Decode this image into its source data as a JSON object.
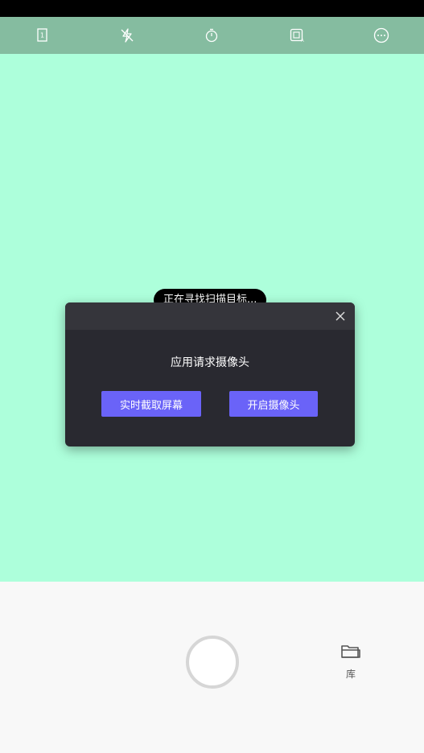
{
  "toolbar": {
    "icons": [
      "page-counter-icon",
      "flash-off-icon",
      "timer-icon",
      "auto-crop-icon",
      "more-icon"
    ],
    "page_counter": "1"
  },
  "viewfinder": {
    "scan_hint": "正在寻找扫描目标..."
  },
  "dialog": {
    "title": "应用请求摄像头",
    "button_screen": "实时截取屏幕",
    "button_camera": "开启摄像头"
  },
  "bottom": {
    "library_label": "库"
  },
  "colors": {
    "toolbar_bg": "#85bca0",
    "viewfinder_bg": "#adffdb",
    "dialog_bg": "#292930",
    "accent": "#6a63f8"
  }
}
